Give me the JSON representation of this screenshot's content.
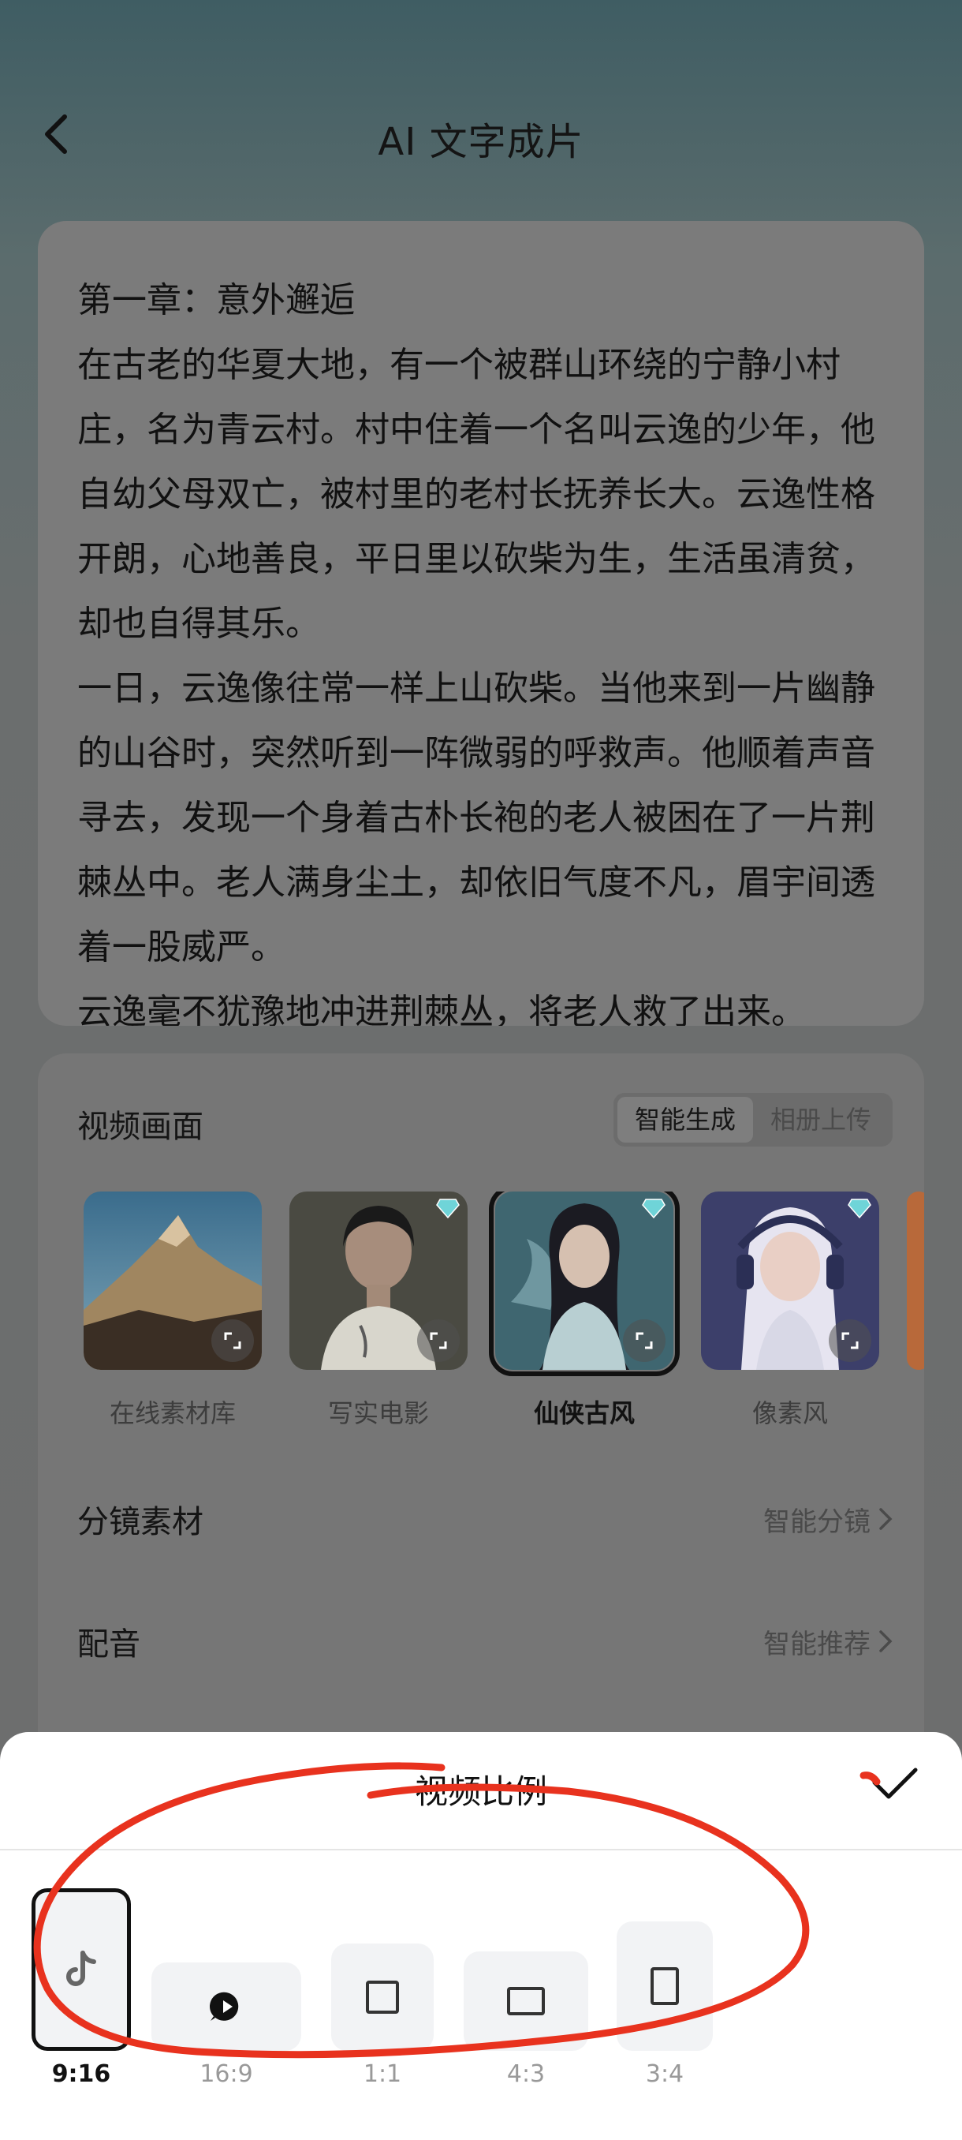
{
  "header": {
    "title": "AI 文字成片"
  },
  "story": {
    "text": "第一章：意外邂逅\n在古老的华夏大地，有一个被群山环绕的宁静小村庄，名为青云村。村中住着一个名叫云逸的少年，他自幼父母双亡，被村里的老村长抚养长大。云逸性格开朗，心地善良，平日里以砍柴为生，生活虽清贫，却也自得其乐。\n一日，云逸像往常一样上山砍柴。当他来到一片幽静的山谷时，突然听到一阵微弱的呼救声。他顺着声音寻去，发现一个身着古朴长袍的老人被困在了一片荆棘丛中。老人满身尘土，却依旧气度不凡，眉宇间透着一股威严。\n云逸毫不犹豫地冲进荆棘丛，将老人救了出来。"
  },
  "video_section": {
    "label": "视频画面",
    "tabs": [
      "智能生成",
      "相册上传"
    ],
    "active_tab": "智能生成",
    "styles": [
      {
        "name": "在线素材库",
        "selected": false
      },
      {
        "name": "写实电影",
        "selected": false
      },
      {
        "name": "仙侠古风",
        "selected": true
      },
      {
        "name": "像素风",
        "selected": false
      }
    ]
  },
  "storyboard": {
    "label": "分镜素材",
    "value": "智能分镜"
  },
  "voiceover": {
    "label": "配音",
    "value": "智能推荐"
  },
  "sheet": {
    "title": "视频比例",
    "ratios": [
      {
        "label": "9:16",
        "icon": "tiktok-icon",
        "selected": true
      },
      {
        "label": "16:9",
        "icon": "play-bubble-icon",
        "selected": false
      },
      {
        "label": "1:1",
        "icon": "square-icon",
        "selected": false
      },
      {
        "label": "4:3",
        "icon": "landscape-rect-icon",
        "selected": false
      },
      {
        "label": "3:4",
        "icon": "portrait-rect-icon",
        "selected": false
      }
    ]
  },
  "colors": {
    "accent": "#111111",
    "annotation": "#e8321e",
    "sheet_bg": "#ffffff"
  }
}
